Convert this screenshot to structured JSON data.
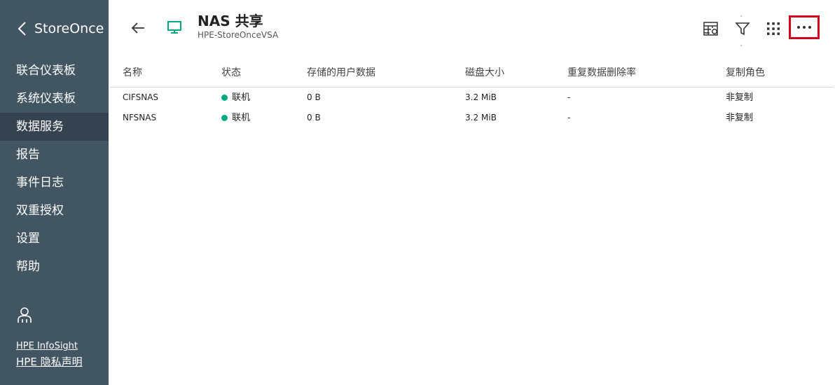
{
  "sidebar": {
    "brand": "StoreOnce",
    "items": [
      {
        "label": "联合仪表板"
      },
      {
        "label": "系统仪表板"
      },
      {
        "label": "数据服务"
      },
      {
        "label": "报告"
      },
      {
        "label": "事件日志"
      },
      {
        "label": "双重授权"
      },
      {
        "label": "设置"
      },
      {
        "label": "帮助"
      }
    ],
    "active_item": "数据服务",
    "links": [
      "HPE InfoSight",
      "HPE 隐私声明"
    ]
  },
  "header": {
    "title": "NAS 共享",
    "subtitle": "HPE-StoreOnceVSA",
    "tools": [
      "table-settings-icon",
      "filter-icon",
      "grid-icon",
      "more-icon"
    ]
  },
  "table": {
    "columns": [
      "名称",
      "状态",
      "存储的用户数据",
      "磁盘大小",
      "重复数据删除率",
      "复制角色"
    ],
    "rows": [
      {
        "name": "CIFSNAS",
        "status": "联机",
        "user_data": "0 B",
        "disk_size": "3.2 MiB",
        "dedupe": "-",
        "role": "非复制"
      },
      {
        "name": "NFSNAS",
        "status": "联机",
        "user_data": "0 B",
        "disk_size": "3.2 MiB",
        "dedupe": "-",
        "role": "非复制"
      }
    ]
  },
  "colors": {
    "sidebar_bg": "#425563",
    "active_bg": "#34434f",
    "accent": "#01a982",
    "highlight": "#d0021b"
  }
}
